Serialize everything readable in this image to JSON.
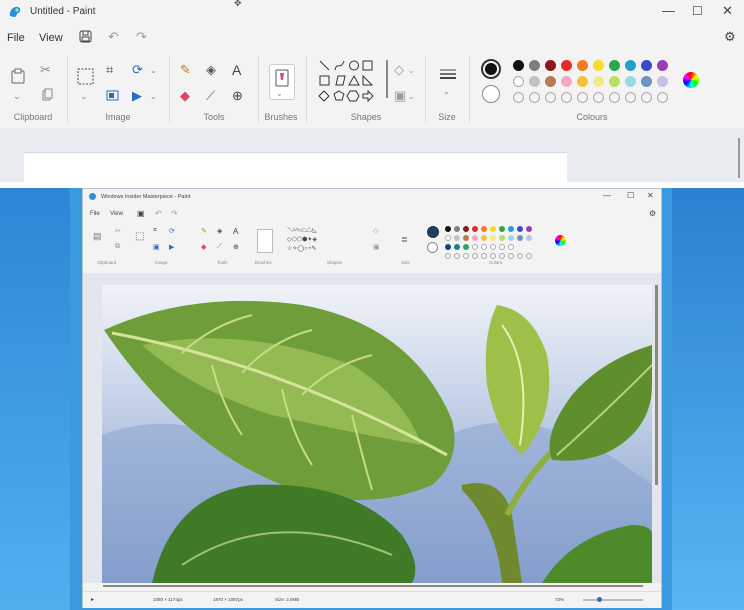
{
  "top_window": {
    "title": "Untitled - Paint",
    "menu": {
      "file": "File",
      "view": "View"
    },
    "groups": {
      "clipboard": "Clipboard",
      "image": "Image",
      "tools": "Tools",
      "brushes": "Brushes",
      "shapes": "Shapes",
      "size": "Size",
      "colours": "Colours"
    },
    "palette_row1": [
      "#111111",
      "#7f7f7f",
      "#8b1a1a",
      "#e32b2b",
      "#f27a21",
      "#f7dd2a",
      "#2fa64a",
      "#27a0c8",
      "#3b49c8",
      "#9a3fb1"
    ],
    "palette_row2": [
      "#ffffff",
      "#c3c3c3",
      "#b97a57",
      "#f5a8c8",
      "#f7c23b",
      "#f3e98d",
      "#b5e061",
      "#9ad9ea",
      "#7092be",
      "#c8bfe7"
    ],
    "primary_color": "#111111",
    "secondary_color": "#ffffff"
  },
  "bottom_window": {
    "title": "Windows Insider Masterpiece - Paint",
    "menu": {
      "file": "File",
      "view": "View"
    },
    "groups": {
      "clipboard": "Clipboard",
      "image": "Image",
      "tools": "Tools",
      "brushes": "Brushes",
      "shapes": "Shapes",
      "size": "Size",
      "colors": "Colors"
    },
    "status": {
      "dimensions": "1080 × 1174px",
      "selection": "1870 × 1087px",
      "size": "Size: 2.5MB",
      "zoom": "73%"
    },
    "palette_row1": [
      "#111111",
      "#7f7f7f",
      "#8b1a1a",
      "#e32b2b",
      "#f27a21",
      "#f7dd2a",
      "#2fa64a",
      "#27a0c8",
      "#3b49c8",
      "#9a3fb1"
    ],
    "palette_row2": [
      "#ffffff",
      "#c3c3c3",
      "#b97a57",
      "#f5a8c8",
      "#f7c23b",
      "#f3e98d",
      "#b5e061",
      "#9ad9ea",
      "#7092be",
      "#c8bfe7"
    ],
    "palette_row3": [
      "#114477",
      "#1b7f8f",
      "#3aa06a",
      "#ffffff",
      "#ffffff",
      "#ffffff",
      "#ffffff",
      "#ffffff"
    ],
    "primary_color": "#1b3f66"
  }
}
